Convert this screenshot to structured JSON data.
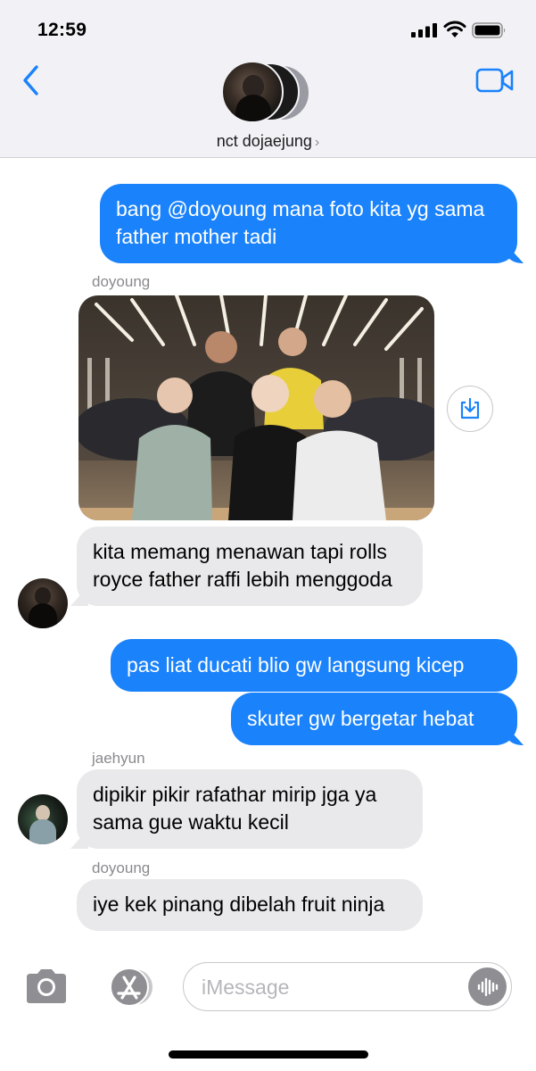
{
  "status_bar": {
    "time": "12:59"
  },
  "header": {
    "chat_name": "nct dojaejung",
    "chevron": "›",
    "icons": [
      "back-chevron-icon",
      "video-camera-icon"
    ]
  },
  "messages": [
    {
      "id": "m1",
      "direction": "outgoing",
      "text": "bang @doyoung mana foto kita yg sama father mother tadi"
    },
    {
      "id": "m2",
      "direction": "incoming",
      "sender": "doyoung",
      "type": "photo",
      "photo_alt": "group photo in front of cars"
    },
    {
      "id": "m3",
      "direction": "incoming",
      "text": "kita memang menawan tapi rolls royce father raffi lebih menggoda"
    },
    {
      "id": "m4",
      "direction": "outgoing",
      "text": "pas liat ducati blio gw langsung kicep"
    },
    {
      "id": "m5",
      "direction": "outgoing",
      "text": "skuter gw bergetar hebat"
    },
    {
      "id": "m6",
      "direction": "incoming",
      "sender": "jaehyun",
      "text": "dipikir pikir rafathar mirip jga ya sama gue waktu kecil"
    },
    {
      "id": "m7",
      "direction": "incoming",
      "sender": "doyoung",
      "text": "iye kek pinang dibelah fruit ninja"
    }
  ],
  "input_bar": {
    "placeholder": "iMessage",
    "icons": [
      "camera-icon",
      "app-store-icon",
      "audio-waveform-icon"
    ]
  },
  "colors": {
    "outgoing_bubble": "#1a82fb",
    "incoming_bubble": "#e9e9eb",
    "accent": "#1a82fb",
    "header_bg": "#f2f2f6"
  }
}
